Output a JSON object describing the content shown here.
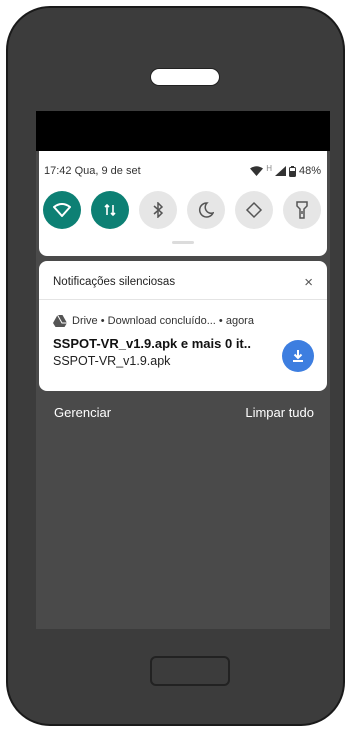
{
  "status_bar": {
    "datetime": "17:42 Qua, 9 de set",
    "network_type": "H",
    "battery": "48%"
  },
  "quick_settings": {
    "tiles": [
      {
        "name": "wifi-icon",
        "state": "on"
      },
      {
        "name": "mobile-data-icon",
        "state": "on"
      },
      {
        "name": "bluetooth-icon",
        "state": "off"
      },
      {
        "name": "do-not-disturb-icon",
        "state": "off"
      },
      {
        "name": "auto-rotate-icon",
        "state": "off"
      },
      {
        "name": "flashlight-icon",
        "state": "off"
      }
    ],
    "accent_color": "#0d8074"
  },
  "notification_group": {
    "header": "Notificações silenciosas",
    "close_symbol": "×"
  },
  "notification": {
    "app_line": "Drive • Download concluído... • agora",
    "title": "SSPOT-VR_v1.9.apk e mais 0 it..",
    "text": "SSPOT-VR_v1.9.apk",
    "button_color": "#3d7ee0"
  },
  "actions": {
    "manage": "Gerenciar",
    "clear_all": "Limpar tudo"
  }
}
